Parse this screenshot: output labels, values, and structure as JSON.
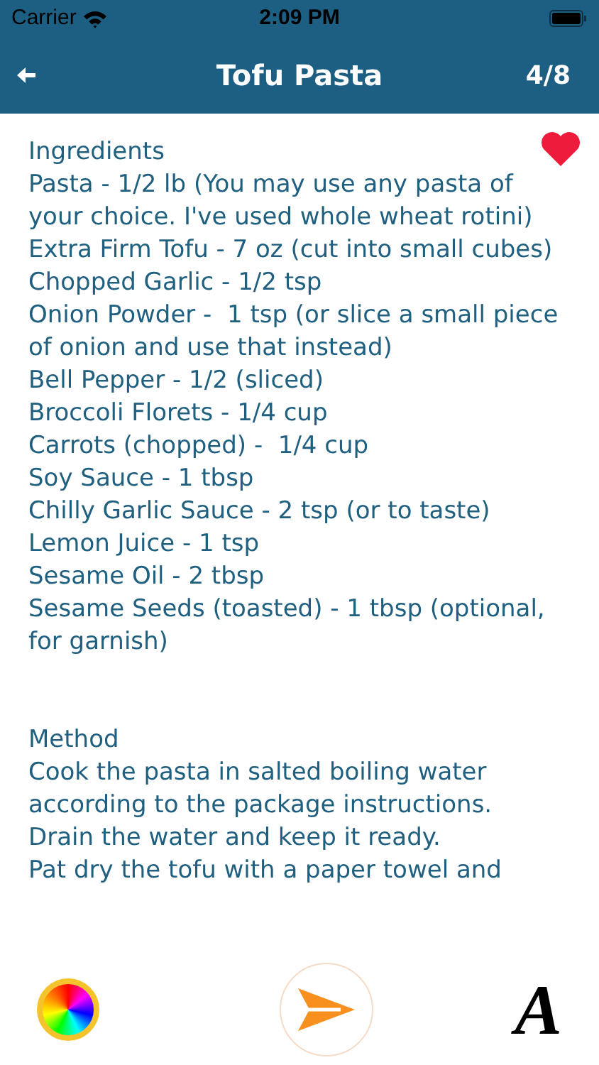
{
  "status_bar": {
    "carrier": "Carrier",
    "time": "2:09 PM"
  },
  "header": {
    "title": "Tofu Pasta",
    "position": "4/8"
  },
  "favorite": true,
  "sections": [
    {
      "heading": "Ingredients",
      "lines": [
        "Pasta - 1/2 lb (You may use any pasta of your choice. I've used whole wheat rotini)",
        "Extra Firm Tofu - 7 oz (cut into small cubes)",
        "Chopped Garlic - 1/2 tsp",
        "Onion Powder -  1 tsp (or slice a small piece of onion and use that instead)",
        "Bell Pepper - 1/2 (sliced)",
        "Broccoli Florets - 1/4 cup",
        "Carrots (chopped) -  1/4 cup",
        "Soy Sauce - 1 tbsp",
        "Chilly Garlic Sauce - 2 tsp (or to taste)",
        "Lemon Juice - 1 tsp",
        "Sesame Oil - 2 tbsp",
        "Sesame Seeds (toasted) - 1 tbsp (optional, for garnish)"
      ]
    },
    {
      "heading": "Method",
      "lines": [
        "Cook the pasta in salted boiling water according to the package instructions.",
        "Drain the water and keep it ready.",
        "Pat dry the tofu with a paper towel and"
      ]
    }
  ],
  "font_button": "A"
}
